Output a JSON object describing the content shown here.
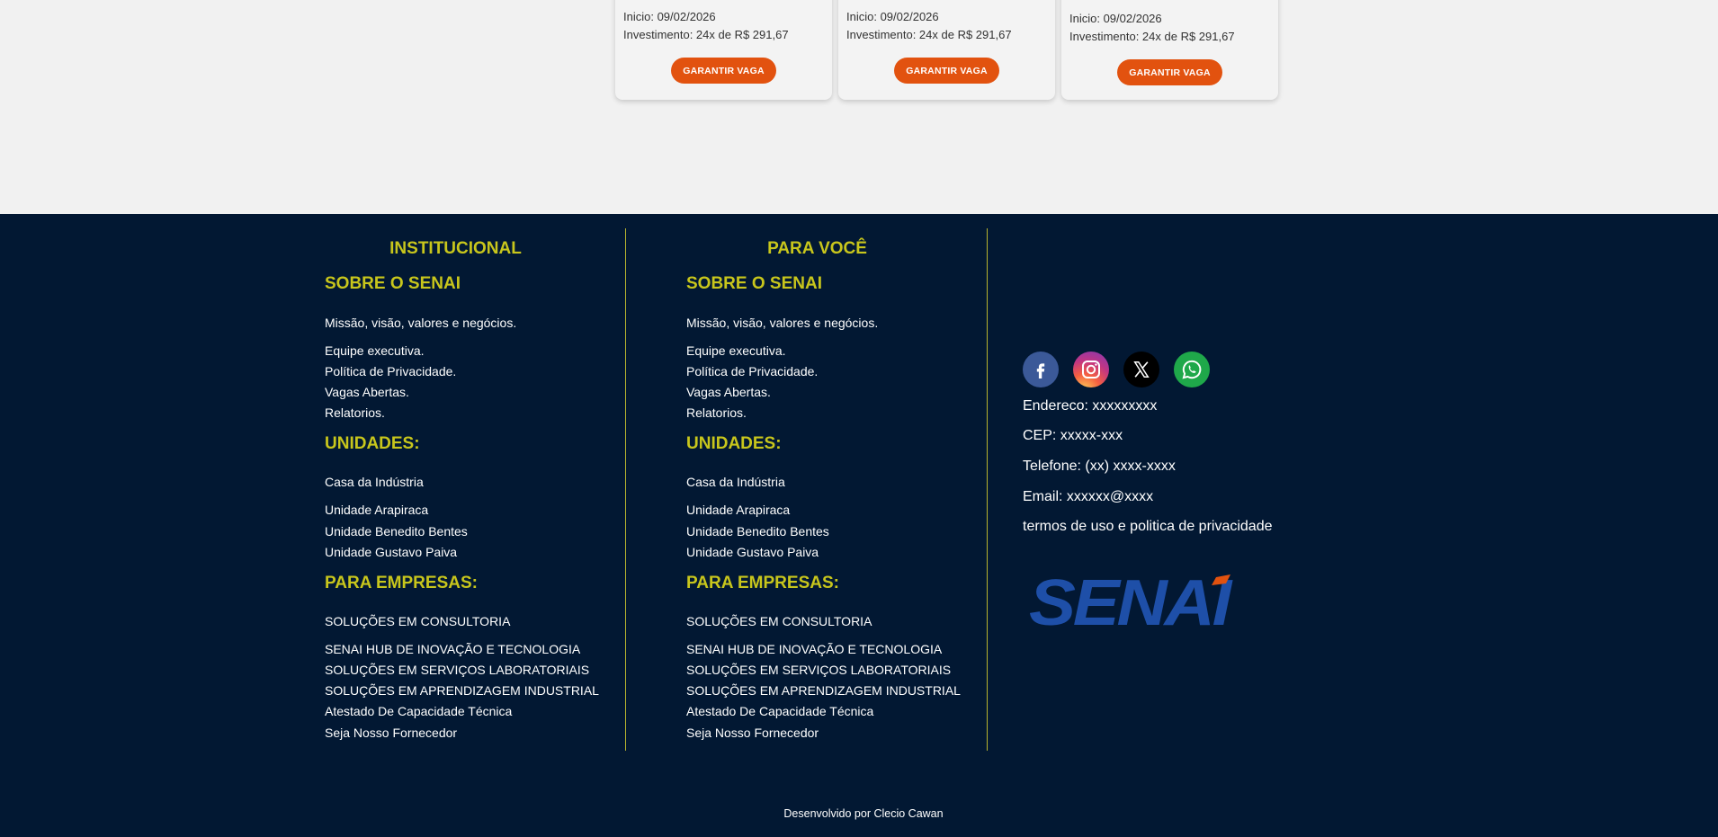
{
  "cards": [
    {
      "inicio": "Inicio: 09/02/2026",
      "investimento": "Investimento: 24x de R$ 291,67",
      "button": "GARANTIR VAGA"
    },
    {
      "inicio": "Inicio: 09/02/2026",
      "investimento": "Investimento: 24x de R$ 291,67",
      "button": "GARANTIR VAGA"
    },
    {
      "inicio": "Inicio: 09/02/2026",
      "investimento": "Investimento: 24x de R$ 291,67",
      "button": "GARANTIR VAGA"
    }
  ],
  "footer": {
    "columns": [
      {
        "title": "INSTITUCIONAL",
        "sobre_head": "SOBRE O SENAI",
        "sobre": [
          "Missão, visão, valores e negócios.",
          "Equipe executiva.",
          "Política de Privacidade.",
          "Vagas Abertas.",
          "Relatorios."
        ],
        "unidades_head": "UNIDADES:",
        "unidades": [
          "Casa da Indústria",
          "Unidade Arapiraca",
          "Unidade Benedito Bentes",
          "Unidade Gustavo Paiva"
        ],
        "empresas_head": "PARA EMPRESAS:",
        "empresas": [
          "SOLUÇÕES EM CONSULTORIA",
          "SENAI HUB DE INOVAÇÃO E TECNOLOGIA",
          "SOLUÇÕES EM SERVIÇOS LABORATORIAIS",
          "SOLUÇÕES EM APRENDIZAGEM INDUSTRIAL",
          "Atestado De Capacidade Técnica",
          "Seja Nosso Fornecedor"
        ]
      },
      {
        "title": "PARA VOCÊ",
        "sobre_head": "SOBRE O SENAI",
        "sobre": [
          "Missão, visão, valores e negócios.",
          "Equipe executiva.",
          "Política de Privacidade.",
          "Vagas Abertas.",
          "Relatorios."
        ],
        "unidades_head": "UNIDADES:",
        "unidades": [
          "Casa da Indústria",
          "Unidade Arapiraca",
          "Unidade Benedito Bentes",
          "Unidade Gustavo Paiva"
        ],
        "empresas_head": "PARA EMPRESAS:",
        "empresas": [
          "SOLUÇÕES EM CONSULTORIA",
          "SENAI HUB DE INOVAÇÃO E TECNOLOGIA",
          "SOLUÇÕES EM SERVIÇOS LABORATORIAIS",
          "SOLUÇÕES EM APRENDIZAGEM INDUSTRIAL",
          "Atestado De Capacidade Técnica",
          "Seja Nosso Fornecedor"
        ]
      }
    ],
    "social_icons": [
      "facebook-icon",
      "instagram-icon",
      "x-icon",
      "whatsapp-icon"
    ],
    "contact": {
      "endereco": "Endereco: xxxxxxxxx",
      "cep": "CEP: xxxxx-xxx",
      "telefone": "Telefone: (xx) xxxx-xxxx",
      "email": "Email: xxxxxx@xxxx",
      "termos": "termos de uso e politica de privacidade"
    },
    "logo_text": "SENAI",
    "credit": "Desenvolvido por Clecio Cawan"
  },
  "colors": {
    "accent_orange": "#e2520f",
    "footer_bg": "#021833",
    "heading_yellow": "#c8c61c",
    "logo_blue": "#1e4fa8"
  }
}
